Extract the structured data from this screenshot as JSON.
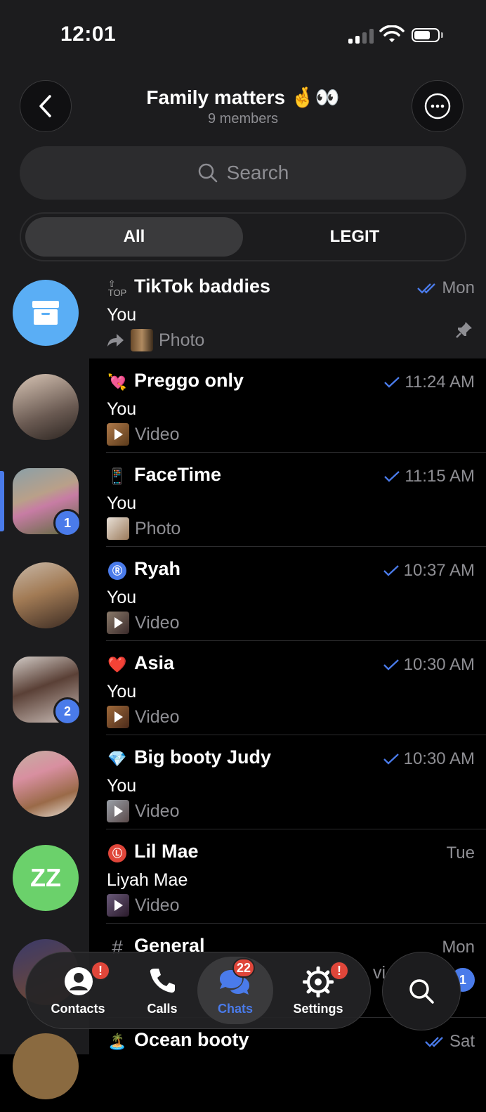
{
  "status": {
    "time": "12:01"
  },
  "header": {
    "title": "Family matters 🤞👀",
    "subtitle": "9 members"
  },
  "search": {
    "placeholder": "Search"
  },
  "tabs": [
    "All",
    "LEGIT"
  ],
  "chats": [
    {
      "name": "TikTok baddies",
      "emoji": "🔝",
      "sender": "You",
      "preview": "Photo",
      "time": "Mon",
      "read": "double",
      "forwarded": true,
      "pinned": true
    },
    {
      "name": "Preggo only",
      "emoji": "💘",
      "sender": "You",
      "preview": "Video",
      "time": "11:24 AM",
      "read": "single"
    },
    {
      "name": "FaceTime",
      "emoji": "📱",
      "sender": "You",
      "preview": "Photo",
      "time": "11:15 AM",
      "read": "single"
    },
    {
      "name": "Ryah",
      "emoji": "Ⓡ",
      "sender": "You",
      "preview": "Video",
      "time": "10:37 AM",
      "read": "single"
    },
    {
      "name": "Asia",
      "emoji": "❤️",
      "sender": "You",
      "preview": "Video",
      "time": "10:30 AM",
      "read": "single"
    },
    {
      "name": "Big booty Judy",
      "emoji": "💎",
      "sender": "You",
      "preview": "Video",
      "time": "10:30 AM",
      "read": "single"
    },
    {
      "name": "Lil Mae",
      "emoji": "Ⓛ",
      "sender": "Liyah Mae",
      "preview": "Video",
      "time": "Tue",
      "read": "none"
    },
    {
      "name": "General",
      "emoji": "#",
      "sender": "",
      "preview": "vi",
      "time": "Mon",
      "read": "none"
    },
    {
      "name": "Ocean booty",
      "emoji": "🏝️",
      "sender": "",
      "preview": "",
      "time": "Sat",
      "read": "double"
    }
  ],
  "folders": [
    {
      "label": "ZZ"
    },
    {
      "badge": "1"
    },
    {
      "badge": "2"
    },
    {
      "badge": "1"
    }
  ],
  "nav": {
    "contacts": "Contacts",
    "calls": "Calls",
    "chats": "Chats",
    "settings": "Settings",
    "contacts_badge": "!",
    "chats_badge": "22",
    "settings_badge": "!"
  },
  "colors": {
    "accent": "#4a7bea",
    "badge_red": "#e0463a",
    "bg": "#000000",
    "panel": "#1c1c1e"
  }
}
